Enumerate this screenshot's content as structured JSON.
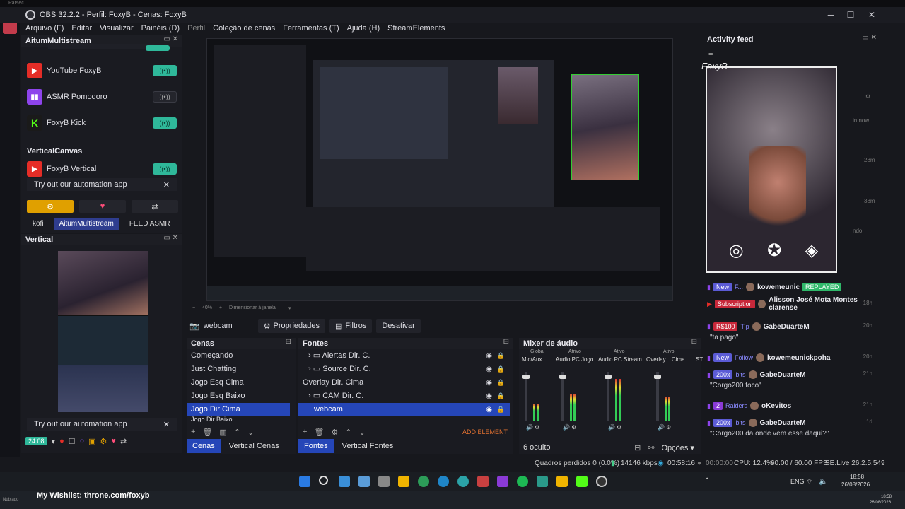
{
  "parsec": {
    "title": "Parsec"
  },
  "window": {
    "title": "OBS 32.2.2 - Perfil: FoxyB - Cenas: FoxyB"
  },
  "menu": [
    "Arquivo (F)",
    "Editar",
    "Visualizar",
    "Painéis (D)",
    "Perfil",
    "Coleção de cenas",
    "Ferramentas (T)",
    "Ajuda (H)",
    "StreamElements"
  ],
  "multistream": {
    "title": "AitumMultistream",
    "rows": [
      {
        "label": "YouTube FoxyB",
        "icon": "youtube-icon",
        "color": "#e52d27",
        "on": true
      },
      {
        "label": "ASMR Pomodoro",
        "icon": "twitch-icon",
        "color": "#8e44ec",
        "on": false
      },
      {
        "label": "FoxyB Kick",
        "icon": "kick-icon",
        "color": "#1a1a1a",
        "on": true
      }
    ],
    "vertical_section": "VerticalCanvas",
    "vertical_row": {
      "label": "FoxyB Vertical",
      "icon": "youtube-icon",
      "color": "#e52d27",
      "on": true
    },
    "try_label": "Try out our automation app",
    "tabs": [
      "kofi",
      "AitumMultistream",
      "FEED ASMR"
    ]
  },
  "vertical": {
    "title": "Vertical",
    "try_label": "Try out our automation app",
    "timer": "24:08"
  },
  "zoom": {
    "percent": "40%",
    "label": "Dimensionar à janela"
  },
  "sourcebar": {
    "source": "webcam",
    "props": "Propriedades",
    "filters": "Filtros",
    "disable": "Desativar"
  },
  "scenes": {
    "title": "Cenas",
    "items": [
      "Começando",
      "Just Chatting",
      "Jogo Esq Cima",
      "Jogo Esq Baixo",
      "Jogo Dir Cima",
      "Jogo Dir Baixo"
    ],
    "selected": 4,
    "tabs": [
      "Cenas",
      "Vertical Cenas"
    ]
  },
  "sources": {
    "title": "Fontes",
    "items": [
      {
        "label": "Alertas Dir. C.",
        "indent": 1,
        "folder": true
      },
      {
        "label": "Source Dir. C.",
        "indent": 1,
        "folder": true
      },
      {
        "label": "Overlay Dir. Cima",
        "indent": 0,
        "folder": false
      },
      {
        "label": "CAM Dir. C.",
        "indent": 1,
        "folder": true
      },
      {
        "label": "webcam",
        "indent": 2,
        "folder": false
      }
    ],
    "selected": 4,
    "add_element": "ADD ELEMENT",
    "tabs": [
      "Fontes",
      "Vertical Fontes"
    ]
  },
  "mixer": {
    "title": "Mixer de áudio",
    "groups": [
      "Global",
      "Atrivo",
      "Ativo",
      "Ativo"
    ],
    "channels": [
      "Mic/Aux",
      "Audio PC Jogo",
      "Audio PC Stream",
      "Overlay... Cima",
      "ST"
    ],
    "hidden": "6 oculto",
    "options": "Opções"
  },
  "feed": {
    "title": "Activity feed",
    "overlay_name": "FoxyB",
    "items": [
      {
        "badge": "New",
        "badge2": "F...",
        "badge_color": "#5b5bd6",
        "who": "kowemeunic",
        "tag": "REPLAYED",
        "time": "",
        "msg": "",
        "platform": "twitch"
      },
      {
        "badge": "Subscription",
        "badge2": "",
        "badge_color": "#c8283a",
        "who": "Alisson José Mota Montes clarense",
        "tag": "",
        "time": "18h",
        "msg": "",
        "platform": "youtube"
      },
      {
        "badge": "R$100",
        "badge2": "Tip",
        "badge_color": "#c8283a",
        "who": "GabeDuarteM",
        "tag": "",
        "time": "20h",
        "msg": "\"ta pago\"",
        "platform": "twitch"
      },
      {
        "badge": "New",
        "badge2": "Follow",
        "badge_color": "#5b5bd6",
        "who": "kowemeunickpoha",
        "tag": "",
        "time": "20h",
        "msg": "",
        "platform": "twitch"
      },
      {
        "badge": "200x",
        "badge2": "bits",
        "badge_color": "#5b5bd6",
        "who": "GabeDuarteM",
        "tag": "",
        "time": "21h",
        "msg": "\"Corgo200 foco\"",
        "platform": "twitch"
      },
      {
        "badge": "2",
        "badge2": "Raiders",
        "badge_color": "#8a3ad6",
        "who": "oKevitos",
        "tag": "",
        "time": "21h",
        "msg": "",
        "platform": "twitch"
      },
      {
        "badge": "200x",
        "badge2": "bits",
        "badge_color": "#5b5bd6",
        "who": "GabeDuarteM",
        "tag": "",
        "time": "1d",
        "msg": "\"Corgo200 da onde vem esse daqui?\"",
        "platform": "twitch"
      }
    ],
    "right_peek": [
      "in now",
      "28m",
      "38m",
      "ndo"
    ]
  },
  "status": {
    "frames": "Quadros perdidos 0 (0.0%)",
    "bitrate": "14146 kbps",
    "live": "00:58:16",
    "rec": "00:00:00",
    "cpu": "CPU: 12.4%",
    "fps": "60.00 / 60.00 FPS",
    "version": "SE.Live 26.2.5.549"
  },
  "taskbar": {
    "wishlist": "My Wishlist: throne.com/foxyb",
    "lang": "ENG",
    "time": "18:58",
    "date": "26/08/2026",
    "time2": "18:58",
    "date2": "26/08/2026",
    "weather": "Nublado"
  },
  "colors": {
    "accent": "#2546b8",
    "toggle_on": "#2fb89a",
    "youtube": "#e52d27",
    "twitch": "#8e44ec",
    "kick": "#53fc18",
    "replayed": "#2fb86a"
  }
}
